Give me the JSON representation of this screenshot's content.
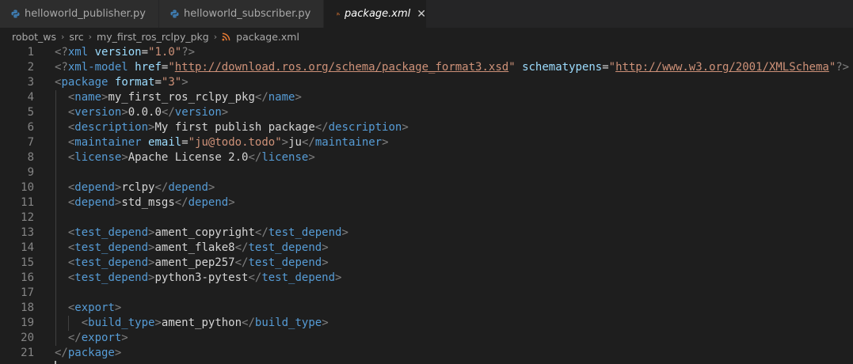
{
  "tabs": [
    {
      "label": "helloworld_publisher.py",
      "icon": "python-icon"
    },
    {
      "label": "helloworld_subscriber.py",
      "icon": "python-icon"
    },
    {
      "label": "package.xml",
      "icon": "rss-icon",
      "active": true
    }
  ],
  "colors": {
    "python_icon": "#3e7bb0",
    "xml_icon": "#e37933",
    "tag": "#569cd6",
    "attr": "#9cdcfe",
    "string": "#ce9178",
    "text": "#d4d4d4",
    "bracket": "#808080"
  },
  "breadcrumb": [
    "robot_ws",
    "src",
    "my_first_ros_rclpy_pkg",
    "package.xml"
  ],
  "lines": [
    {
      "n": "1",
      "code": "<?xml version=\"1.0\"?>"
    },
    {
      "n": "2",
      "code": "<?xml-model href=\"http://download.ros.org/schema/package_format3.xsd\" schematypens=\"http://www.w3.org/2001/XMLSchema\"?>"
    },
    {
      "n": "3",
      "code": "<package format=\"3\">"
    },
    {
      "n": "4",
      "code": "  <name>my_first_ros_rclpy_pkg</name>"
    },
    {
      "n": "5",
      "code": "  <version>0.0.0</version>"
    },
    {
      "n": "6",
      "code": "  <description>My first publish package</description>"
    },
    {
      "n": "7",
      "code": "  <maintainer email=\"ju@todo.todo\">ju</maintainer>"
    },
    {
      "n": "8",
      "code": "  <license>Apache License 2.0</license>"
    },
    {
      "n": "9",
      "code": ""
    },
    {
      "n": "10",
      "code": "  <depend>rclpy</depend>"
    },
    {
      "n": "11",
      "code": "  <depend>std_msgs</depend>"
    },
    {
      "n": "12",
      "code": ""
    },
    {
      "n": "13",
      "code": "  <test_depend>ament_copyright</test_depend>"
    },
    {
      "n": "14",
      "code": "  <test_depend>ament_flake8</test_depend>"
    },
    {
      "n": "15",
      "code": "  <test_depend>ament_pep257</test_depend>"
    },
    {
      "n": "16",
      "code": "  <test_depend>python3-pytest</test_depend>"
    },
    {
      "n": "17",
      "code": ""
    },
    {
      "n": "18",
      "code": "  <export>"
    },
    {
      "n": "19",
      "code": "    <build_type>ament_python</build_type>"
    },
    {
      "n": "20",
      "code": "  </export>"
    },
    {
      "n": "21",
      "code": "</package>"
    }
  ]
}
